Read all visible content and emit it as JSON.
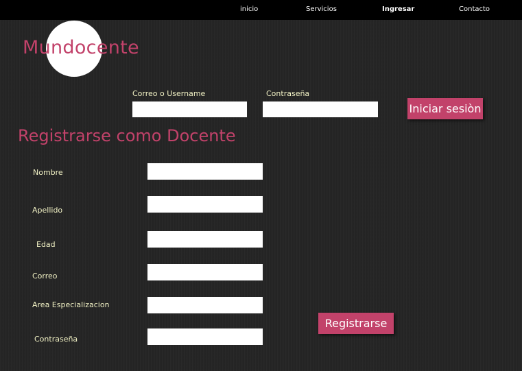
{
  "nav": {
    "items": [
      "inicio",
      "Servicios",
      "Ingresar",
      "Contacto"
    ],
    "active": "Ingresar"
  },
  "logo": {
    "text": "Mundocente"
  },
  "login": {
    "user_label": "Correo o Username",
    "user_value": "",
    "password_label": "Contraseña",
    "password_value": "",
    "submit_label": "Iniciar sesiòn"
  },
  "register": {
    "title": "Registrarse como Docente",
    "fields": [
      {
        "label": "Nombre",
        "value": ""
      },
      {
        "label": "Apellido",
        "value": ""
      },
      {
        "label": "Edad",
        "value": ""
      },
      {
        "label": "Correo",
        "value": ""
      },
      {
        "label": "Area Especializacion",
        "value": ""
      },
      {
        "label": "Contraseña",
        "value": ""
      }
    ],
    "submit_label": "Registrarse"
  },
  "colors": {
    "accent": "#c2426a",
    "label": "#f1f1c4",
    "background": "#252525",
    "topbar": "#000000"
  }
}
